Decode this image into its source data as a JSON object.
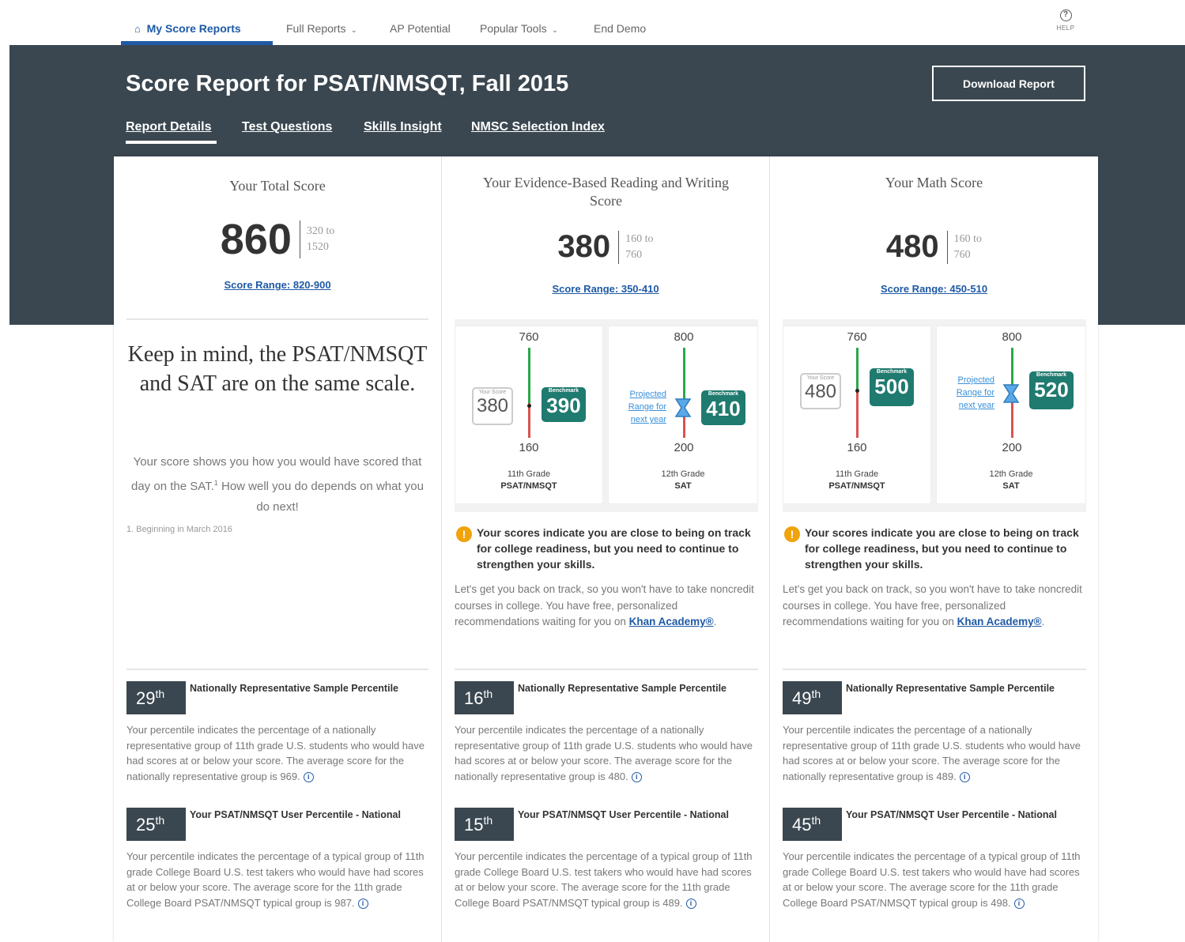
{
  "nav": {
    "my_score_reports": "My Score Reports",
    "full_reports": "Full Reports",
    "ap_potential": "AP Potential",
    "popular_tools": "Popular Tools",
    "end_demo": "End Demo",
    "help": "HELP"
  },
  "banner": {
    "title": "Score Report for PSAT/NMSQT, Fall 2015",
    "download": "Download Report",
    "tabs": [
      "Report Details",
      "Test Questions",
      "Skills Insight",
      "NMSC Selection Index"
    ]
  },
  "total": {
    "title": "Your Total Score",
    "score": "860",
    "range_a": "320 to",
    "range_b": "1520",
    "score_range": "Score Range: 820-900",
    "keep_in_mind": "Keep in mind, the PSAT/NMSQT and SAT are on the same scale.",
    "desc_a": "Your score shows you how you would have scored that day on the SAT.",
    "desc_sup": "1",
    "desc_b": " How well you do depends on what you do next!",
    "footnote": "1. Beginning in March 2016",
    "pct1": "29",
    "pct1_desc": "Your percentile indicates the percentage of a nationally representative group of 11th grade U.S. students who would have had scores at or below your score. The average score for the nationally representative group is 969.",
    "pct2": "25",
    "pct2_desc": "Your percentile indicates the percentage of a typical group of 11th grade College Board U.S. test takers who would have had scores at or below your score. The average score for the 11th grade College Board PSAT/NMSQT typical group is 987."
  },
  "ebrw": {
    "title": "Your Evidence-Based Reading and Writing Score",
    "score": "380",
    "range_a": "160 to",
    "range_b": "760",
    "score_range": "Score Range: 350-410",
    "g1_top": "760",
    "g1_bot": "160",
    "your_score": "380",
    "bench1": "390",
    "g1_grade": "11th Grade",
    "g1_test": "PSAT/NMSQT",
    "g2_top": "800",
    "g2_bot": "200",
    "bench2": "410",
    "g2_grade": "12th Grade",
    "g2_test": "SAT",
    "pct1": "16",
    "pct1_desc": "Your percentile indicates the percentage of a nationally representative group of 11th grade U.S. students who would have had scores at or below your score. The average score for the nationally representative group is 480.",
    "pct2": "15",
    "pct2_desc": "Your percentile indicates the percentage of a typical group of 11th grade College Board U.S. test takers who would have had scores at or below your score. The average score for the 11th grade College Board PSAT/NMSQT typical group is 489."
  },
  "math": {
    "title": "Your Math Score",
    "score": "480",
    "range_a": "160 to",
    "range_b": "760",
    "score_range": "Score Range: 450-510",
    "g1_top": "760",
    "g1_bot": "160",
    "your_score": "480",
    "bench1": "500",
    "g1_grade": "11th Grade",
    "g1_test": "PSAT/NMSQT",
    "g2_top": "800",
    "g2_bot": "200",
    "bench2": "520",
    "g2_grade": "12th Grade",
    "g2_test": "SAT",
    "pct1": "49",
    "pct1_desc": "Your percentile indicates the percentage of a nationally representative group of 11th grade U.S. students who would have had scores at or below your score. The average score for the nationally representative group is 489.",
    "pct2": "45",
    "pct2_desc": "Your percentile indicates the percentage of a typical group of 11th grade College Board U.S. test takers who would have had scores at or below your score. The average score for the 11th grade College Board PSAT/NMSQT typical group is 498."
  },
  "common": {
    "your_score_label": "Your Score",
    "benchmark_label": "Benchmark",
    "projected": "Projected Range for next year",
    "alert": "Your scores indicate you are close to being on track for college readiness, but you need to continue to strengthen your skills.",
    "para": "Let's get you back on track, so you won't have to take noncredit courses in college. You have free, personalized recommendations waiting for you on ",
    "khan": "Khan Academy®",
    "para_end": ".",
    "th": "th",
    "pct1_title": "Nationally Representative Sample Percentile",
    "pct2_title": "Your PSAT/NMSQT User Percentile - National"
  },
  "colors": {
    "dark": "#3a4750",
    "accent": "#1f5aa6",
    "bench": "#1f7a6f",
    "alert": "#f0a30a"
  }
}
